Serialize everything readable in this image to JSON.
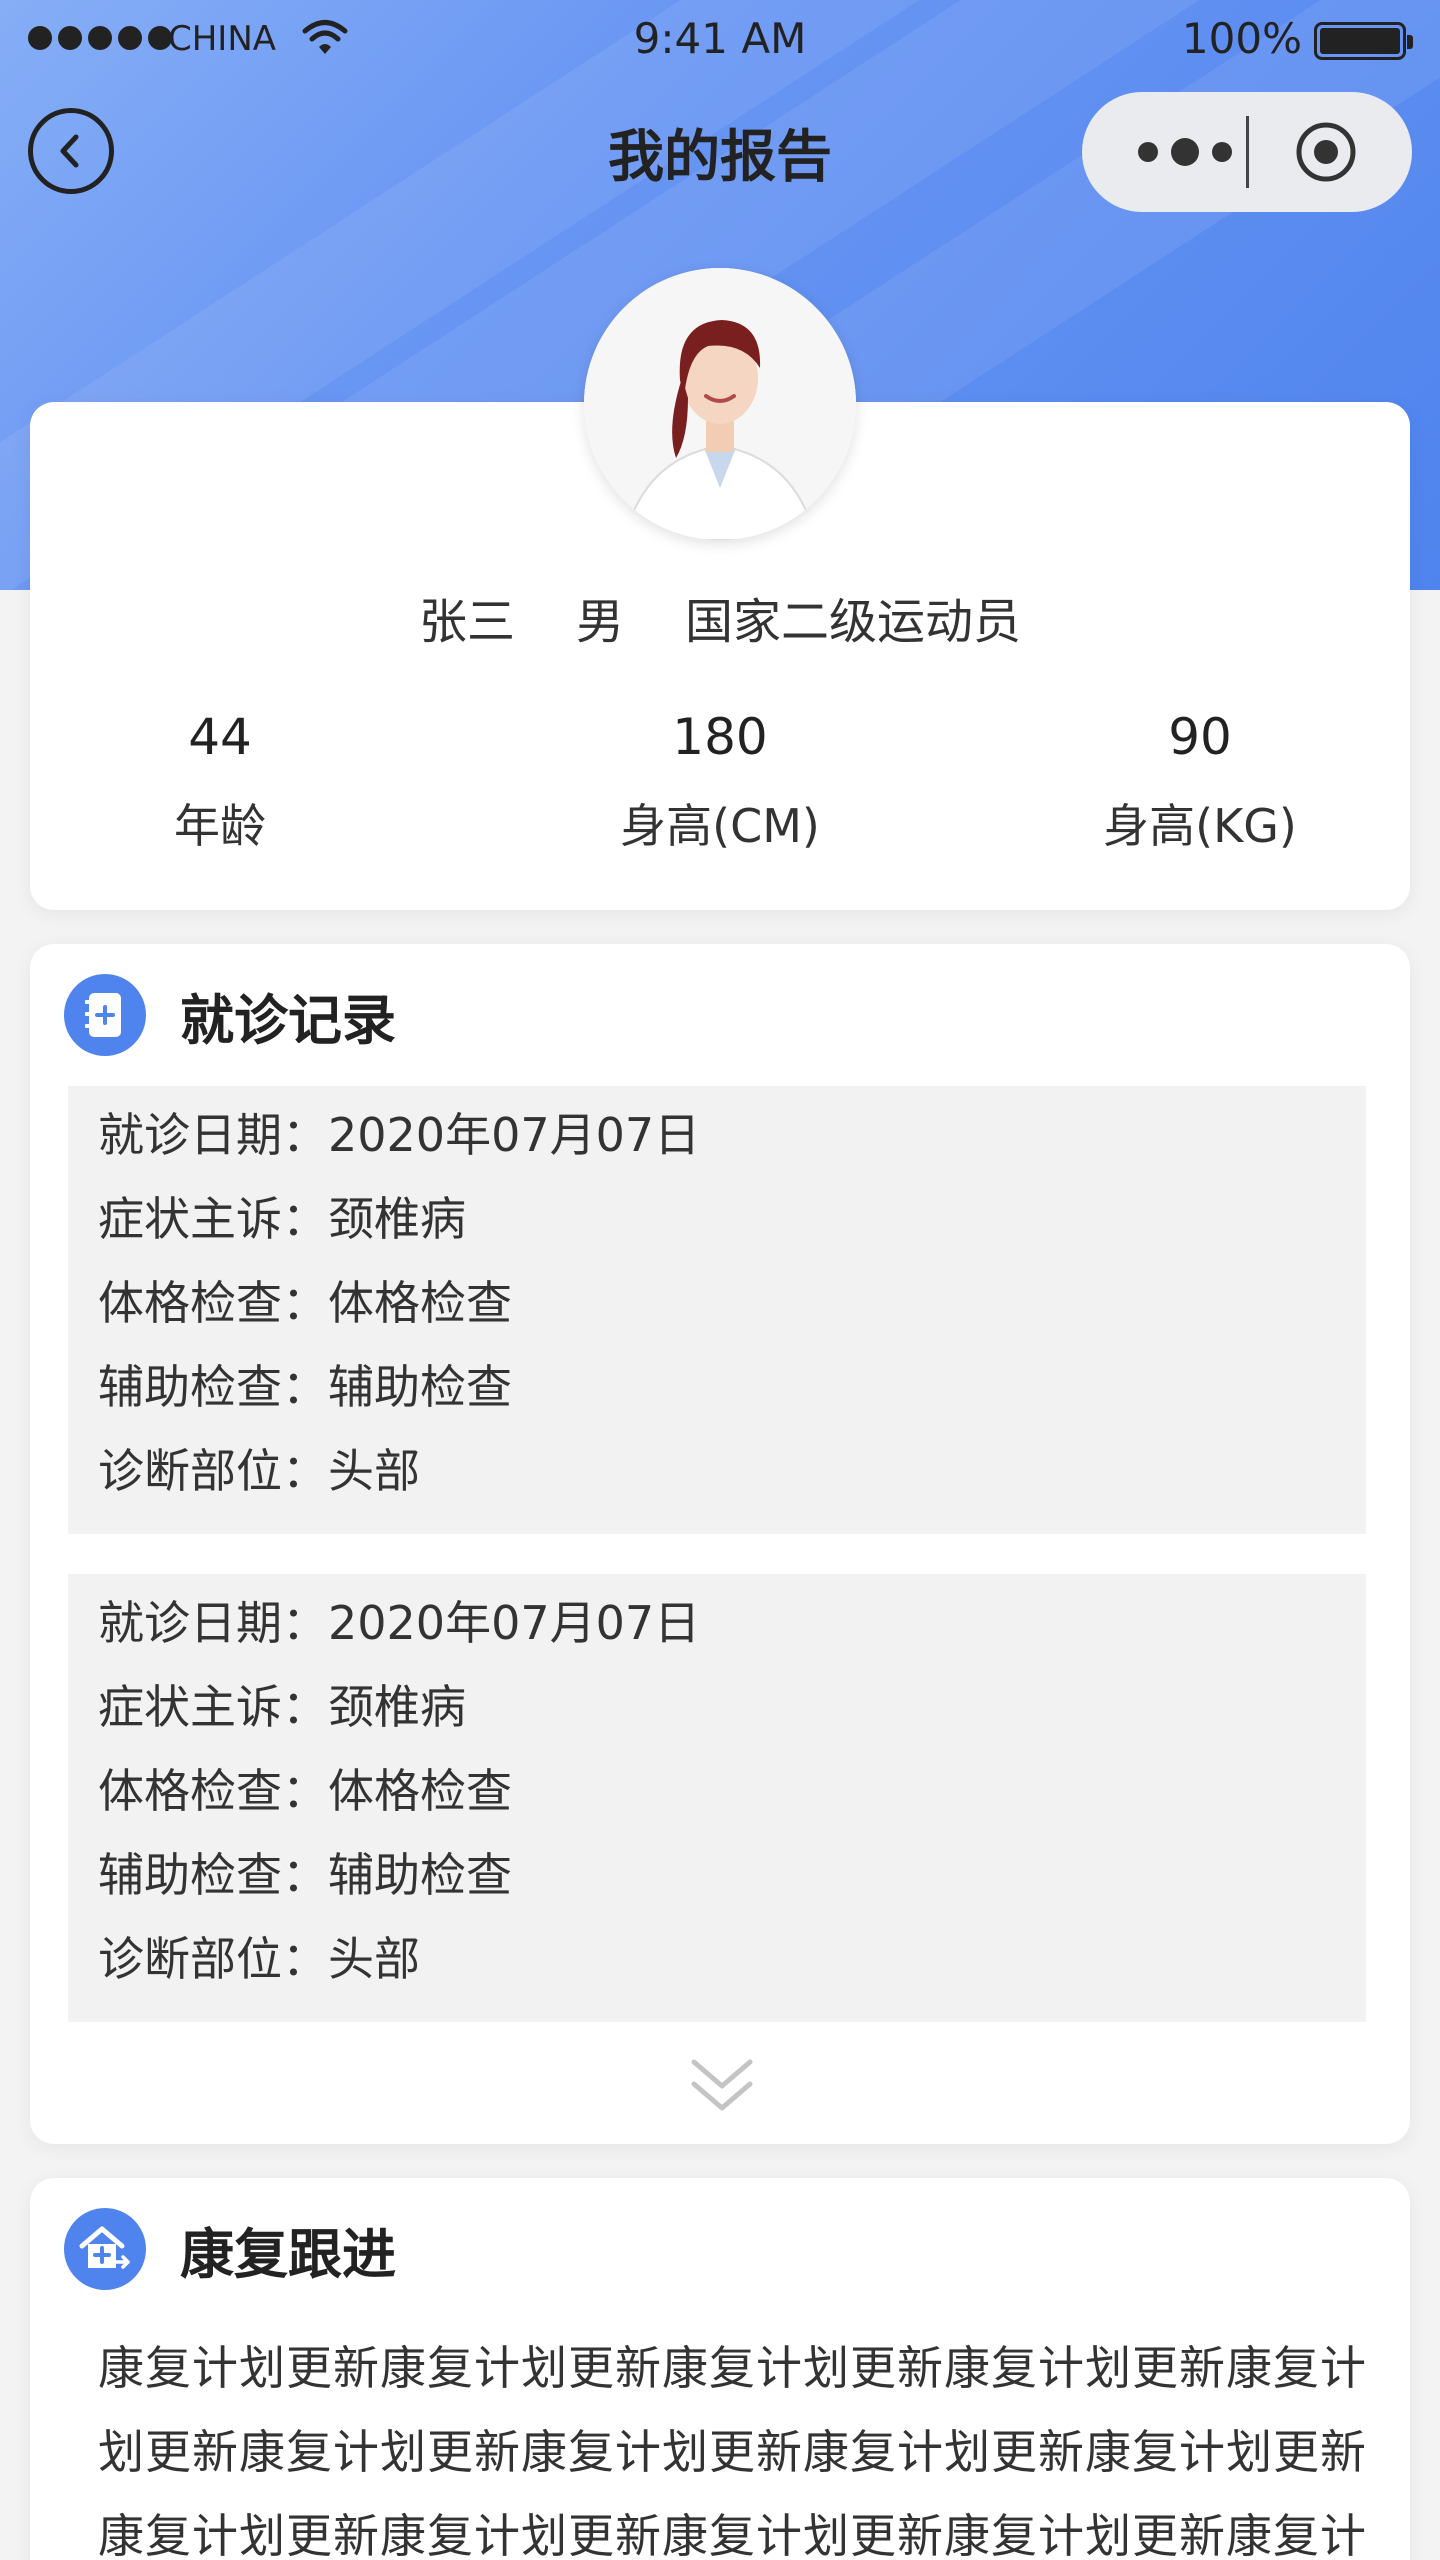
{
  "status_bar": {
    "carrier": "CHINA",
    "time": "9:41 AM",
    "battery": "100%"
  },
  "nav": {
    "title": "我的报告"
  },
  "profile": {
    "name": "张三",
    "gender": "男",
    "level": "国家二级运动员",
    "stats": [
      {
        "value": "44",
        "label": "年龄"
      },
      {
        "value": "180",
        "label": "身高(CM)"
      },
      {
        "value": "90",
        "label": "身高(KG)"
      }
    ]
  },
  "records": {
    "title": "就诊记录",
    "items": [
      {
        "fields": [
          {
            "label": "就诊日期：",
            "value": "2020年07月07日"
          },
          {
            "label": "症状主诉：",
            "value": "颈椎病"
          },
          {
            "label": "体格检查：",
            "value": "体格检查"
          },
          {
            "label": "辅助检查：",
            "value": "辅助检查"
          },
          {
            "label": "诊断部位：",
            "value": "头部"
          }
        ]
      },
      {
        "fields": [
          {
            "label": "就诊日期：",
            "value": "2020年07月07日"
          },
          {
            "label": "症状主诉：",
            "value": "颈椎病"
          },
          {
            "label": "体格检查：",
            "value": "体格检查"
          },
          {
            "label": "辅助检查：",
            "value": "辅助检查"
          },
          {
            "label": "诊断部位：",
            "value": "头部"
          }
        ]
      }
    ]
  },
  "rehab": {
    "title": "康复跟进",
    "text": "康复计划更新康复计划更新康复计划更新康复计划更新康复计划更新康复计划更新康复计划更新康复计划更新康复计划更新康复计划更新康复计划更新康复计划更新康复计划更新康复计划更新"
  },
  "colors": {
    "accent": "#4f84ee",
    "header_gradient_start": "#86aef6",
    "header_gradient_end": "#4f84ee"
  },
  "icons": {
    "back": "chevron-left-icon",
    "more": "more-dots-icon",
    "close": "target-icon",
    "records": "notebook-plus-icon",
    "rehab": "house-plus-icon",
    "expand": "double-chevron-down-icon"
  }
}
